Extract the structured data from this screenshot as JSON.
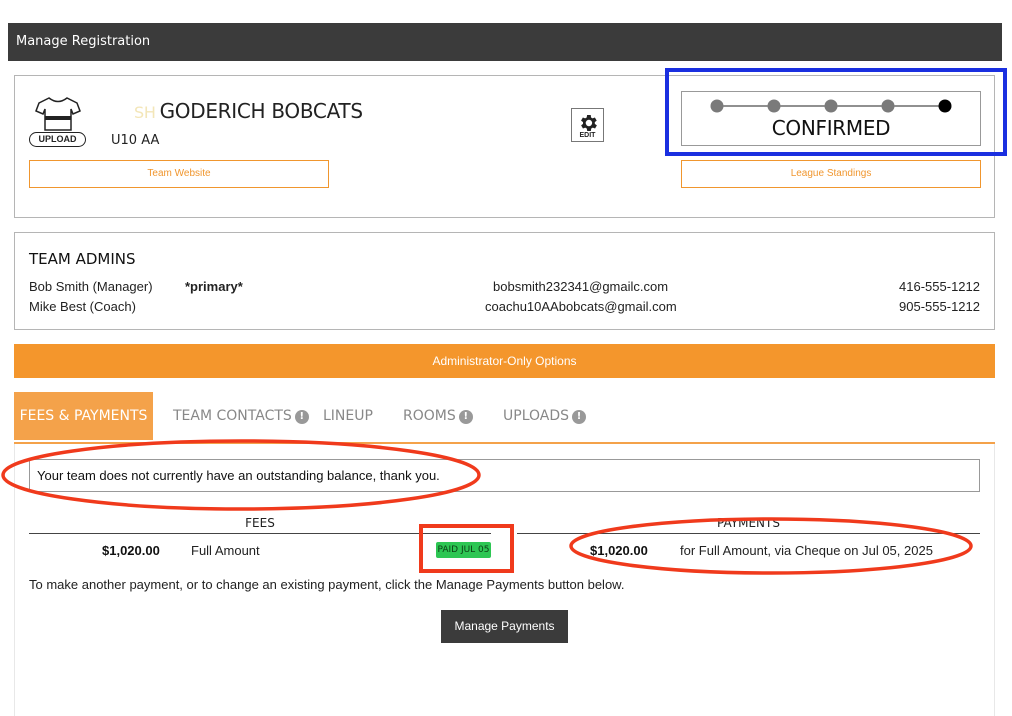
{
  "window": {
    "title": "Manage Registration"
  },
  "team": {
    "jersey_action": "UPLOAD",
    "name_prefix": "SH",
    "name": "GODERICH BOBCATS",
    "division": "U10 AA",
    "edit_label": "EDIT",
    "team_website_label": "Team Website",
    "league_standings_label": "League Standings",
    "status": {
      "label": "CONFIRMED",
      "steps_total": 5,
      "current_step": 5
    }
  },
  "admins": {
    "title": "TEAM ADMINS",
    "rows": [
      {
        "name": "Bob Smith (Manager)",
        "tag": "*primary*",
        "email": "bobsmith232341@gmailc.com",
        "phone": "416-555-1212"
      },
      {
        "name": "Mike Best (Coach)",
        "tag": "",
        "email": "coachu10AAbobcats@gmail.com",
        "phone": "905-555-1212"
      }
    ]
  },
  "admin_options_label": "Administrator-Only Options",
  "tabs": [
    {
      "label": "FEES & PAYMENTS",
      "active": true,
      "alert": false
    },
    {
      "label": "TEAM CONTACTS",
      "active": false,
      "alert": true
    },
    {
      "label": "LINEUP",
      "active": false,
      "alert": false
    },
    {
      "label": "ROOMS",
      "active": false,
      "alert": true
    },
    {
      "label": "UPLOADS",
      "active": false,
      "alert": true
    }
  ],
  "alert_glyph": "!",
  "fees": {
    "balance_message": "Your team does not currently have an outstanding balance, thank you.",
    "fees_header": "FEES",
    "payments_header": "PAYMENTS",
    "fee_amount": "$1,020.00",
    "fee_description": "Full Amount",
    "paid_badge": "PAID JUL 05",
    "payment_amount": "$1,020.00",
    "payment_description": "for Full Amount, via Cheque on Jul 05, 2025",
    "help_text": "To make another payment, or to change an existing payment, click the Manage Payments button below.",
    "manage_button": "Manage Payments"
  },
  "colors": {
    "accent_orange": "#f4962c",
    "dark_bar": "#3b3b3b",
    "paid_green": "#2dc653",
    "annotation_red": "#f03a1c",
    "annotation_blue": "#1a2fe0"
  }
}
